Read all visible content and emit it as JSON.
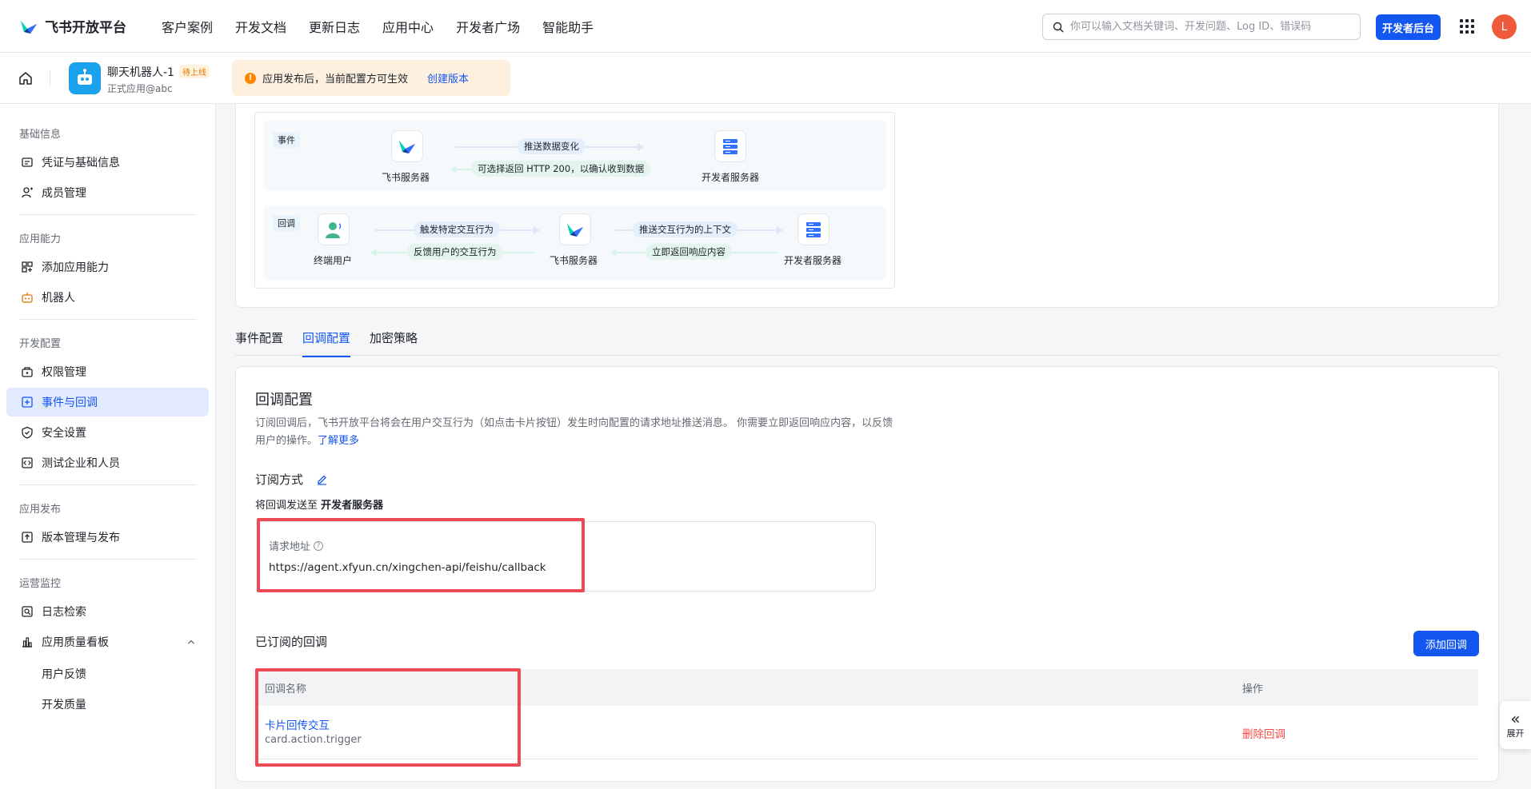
{
  "topnav": {
    "logo_text": "飞书开放平台",
    "links": [
      "客户案例",
      "开发文档",
      "更新日志",
      "应用中心",
      "开发者广场",
      "智能助手"
    ],
    "search_placeholder": "你可以输入文档关键词、开发问题、Log ID、错误码",
    "dev_console": "开发者后台",
    "avatar_letter": "L"
  },
  "app": {
    "name": "聊天机器人-1",
    "status": "待上线",
    "subtitle": "正式应用@abc"
  },
  "notice": {
    "text": "应用发布后，当前配置方可生效",
    "link": "创建版本"
  },
  "sidebar": {
    "groups": [
      {
        "title": "基础信息",
        "items": [
          {
            "label": "凭证与基础信息",
            "icon": "credential-icon"
          },
          {
            "label": "成员管理",
            "icon": "member-icon"
          }
        ]
      },
      {
        "title": "应用能力",
        "items": [
          {
            "label": "添加应用能力",
            "icon": "add-capability-icon"
          },
          {
            "label": "机器人",
            "icon": "robot-icon"
          }
        ]
      },
      {
        "title": "开发配置",
        "items": [
          {
            "label": "权限管理",
            "icon": "permission-icon"
          },
          {
            "label": "事件与回调",
            "icon": "event-callback-icon",
            "active": true
          },
          {
            "label": "安全设置",
            "icon": "security-icon"
          },
          {
            "label": "测试企业和人员",
            "icon": "test-icon"
          }
        ]
      },
      {
        "title": "应用发布",
        "items": [
          {
            "label": "版本管理与发布",
            "icon": "version-icon"
          }
        ]
      },
      {
        "title": "运营监控",
        "items": [
          {
            "label": "日志检索",
            "icon": "log-search-icon"
          },
          {
            "label": "应用质量看板",
            "icon": "quality-board-icon"
          }
        ]
      }
    ],
    "subitems": [
      "用户反馈",
      "开发质量"
    ]
  },
  "diagram": {
    "event_tag": "事件",
    "callback_tag": "回调",
    "event_push": "推送数据变化",
    "event_return": "可选择返回 HTTP 200，以确认收到数据",
    "feishu_server": "飞书服务器",
    "dev_server": "开发者服务器",
    "end_user": "终端用户",
    "trigger": "触发特定交互行为",
    "feedback": "反馈用户的交互行为",
    "push_context": "推送交互行为的上下文",
    "respond": "立即返回响应内容"
  },
  "tabs": [
    "事件配置",
    "回调配置",
    "加密策略"
  ],
  "config": {
    "title": "回调配置",
    "desc": "订阅回调后，飞书开放平台将会在用户交互行为（如点击卡片按钮）发生时向配置的请求地址推送消息。 你需要立即返回响应内容，以反馈用户的操作。",
    "learn_more": "了解更多",
    "method_title": "订阅方式",
    "send_prefix": "将回调发送至 ",
    "send_target": "开发者服务器",
    "url_label": "请求地址",
    "url_value": "https://agent.xfyun.cn/xingchen-api/feishu/callback",
    "subscribed_title": "已订阅的回调",
    "add_button": "添加回调",
    "col_name": "回调名称",
    "col_op": "操作",
    "rows": [
      {
        "name": "卡片回传交互",
        "key": "card.action.trigger",
        "op": "删除回调"
      }
    ]
  },
  "expand_label": "展开",
  "colors": {
    "primary": "#1456f0",
    "danger": "#f54a45",
    "highlight": "#ee4a55"
  }
}
